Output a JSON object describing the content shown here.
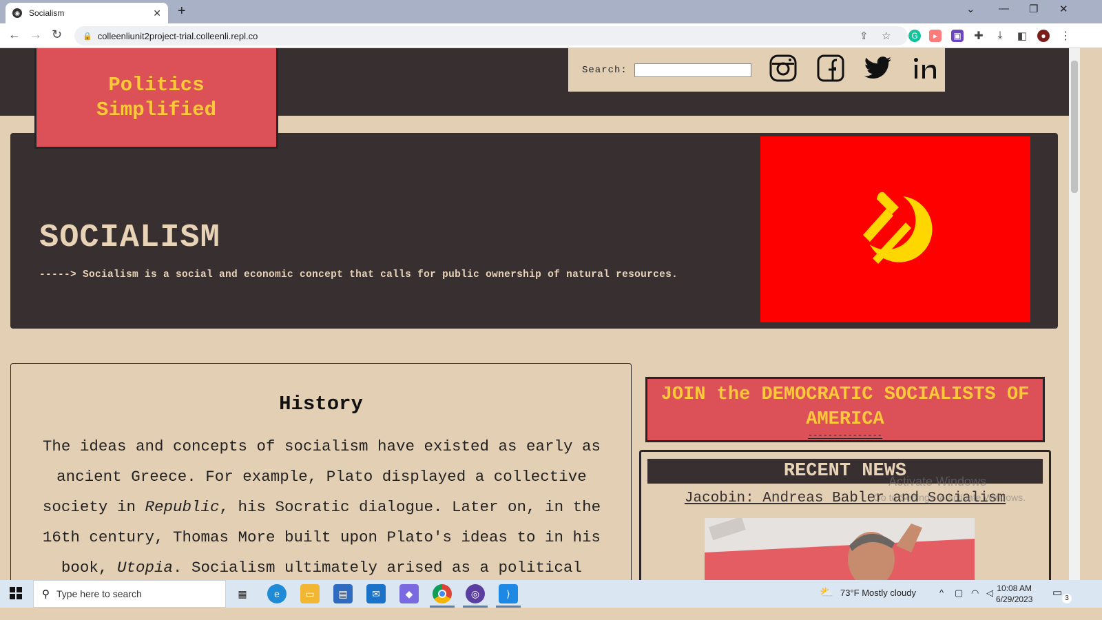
{
  "browser": {
    "tab_title": "Socialism",
    "url": "colleenliunit2project-trial.colleenli.repl.co"
  },
  "site": {
    "logo_text": "Politics Simplified",
    "search_label": "Search:",
    "search_value": "",
    "social_icons": [
      "instagram-icon",
      "facebook-icon",
      "twitter-icon",
      "linkedin-icon"
    ]
  },
  "hero": {
    "title": "SOCIALISM",
    "subtitle": "-----> Socialism is a social and economic concept that calls for public ownership of natural resources."
  },
  "history": {
    "heading": "History",
    "text_1": "The ideas and concepts of socialism have existed as early as ancient Greece. For example, Plato displayed a collective society in ",
    "em_1": "Republic",
    "text_2": ", his Socratic dialogue. Later on, in the 16th century, Thomas More built upon Plato's ideas to in his book, ",
    "em_2": "Utopia",
    "text_3": ". Socialism ultimately arised as a political"
  },
  "sidebar": {
    "join_text": "JOIN the DEMOCRATIC SOCIALISTS OF AMERICA",
    "join_link": "---------------",
    "news_heading": "RECENT NEWS",
    "news_link": "Jacobin: Andreas Babler and Socialism"
  },
  "watermark": {
    "line1": "Activate Windows",
    "line2": "Go to Settings to activate Windows."
  },
  "taskbar": {
    "search_placeholder": "Type here to search",
    "weather": "73°F  Mostly cloudy",
    "time": "10:08 AM",
    "date": "6/29/2023",
    "notification_count": "3"
  },
  "colors": {
    "header_dark": "#382f30",
    "logo_red": "#dc5157",
    "logo_yellow": "#ffc93a",
    "page_beige": "#e3cfb4",
    "flag_red": "#ff0000"
  }
}
